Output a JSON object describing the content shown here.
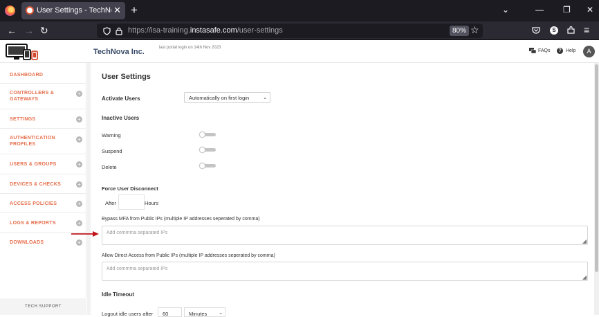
{
  "browser": {
    "tab_title": "User Settings - TechNova Inc. | Ins",
    "url_prefix": "https://isa-training.",
    "url_domain": "instasafe.com",
    "url_path": "/user-settings",
    "zoom": "80%"
  },
  "header": {
    "org_name": "TechNova Inc.",
    "last_login": "last portal login on 14th Nov 2023",
    "faqs": "FAQs",
    "help": "Help",
    "avatar": "A"
  },
  "sidebar": {
    "items": [
      {
        "label": "DASHBOARD"
      },
      {
        "label": "CONTROLLERS &\nGATEWAYS"
      },
      {
        "label": "SETTINGS"
      },
      {
        "label": "AUTHENTICATION\nPROFILES"
      },
      {
        "label": "USERS & GROUPS"
      },
      {
        "label": "DEVICES & CHECKS"
      },
      {
        "label": "ACCESS POLICIES"
      },
      {
        "label": "LOGS & REPORTS"
      },
      {
        "label": "DOWNLOADS"
      }
    ],
    "tech_support": "TECH SUPPORT"
  },
  "main": {
    "title": "User Settings",
    "activate_users_label": "Activate Users",
    "activate_users_value": "Automatically on first login",
    "inactive_users_label": "Inactive Users",
    "warning": "Warning",
    "suspend": "Suspend",
    "delete": "Delete",
    "force_disconnect_label": "Force User Disconnect",
    "after": "After",
    "hours": "Hours",
    "bypass_mfa_label": "Bypass MFA from Public IPs (multiple IP addresses seperated by comma)",
    "bypass_mfa_placeholder": "Add commma separated IPs",
    "direct_access_label": "Allow Direct Access from Public IPs (multiple IP addresses seperated by comma)",
    "direct_access_placeholder": "Add commma separated IPs",
    "idle_timeout_label": "Idle Timeout",
    "logout_idle_label": "Logout idle users after",
    "idle_value": "60",
    "idle_unit": "Minutes"
  },
  "colors": {
    "accent": "#e56e4b",
    "brand_text": "#374a66",
    "annotation_arrow": "#c0141a"
  }
}
